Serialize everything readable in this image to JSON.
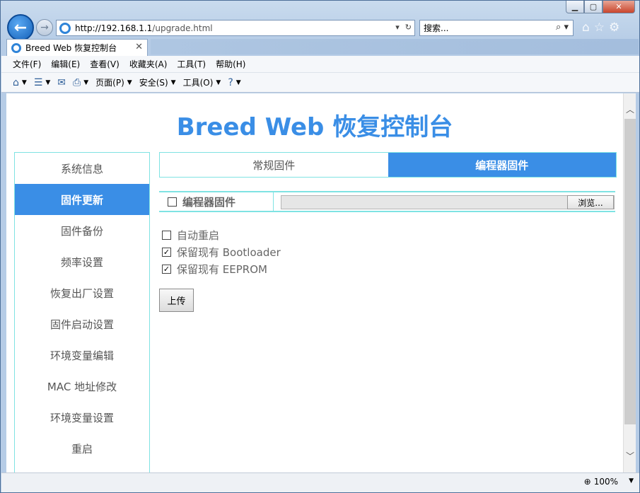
{
  "browser": {
    "url_host": "http://192.168.1.1",
    "url_path": "/upgrade.html",
    "search_placeholder": "搜索...",
    "tab_title": "Breed Web 恢复控制台",
    "menu": [
      "文件(F)",
      "编辑(E)",
      "查看(V)",
      "收藏夹(A)",
      "工具(T)",
      "帮助(H)"
    ],
    "commands": {
      "page": "页面(P)",
      "safety": "安全(S)",
      "tools": "工具(O)"
    },
    "zoom": "100%"
  },
  "page": {
    "title": "Breed Web 恢复控制台",
    "sidebar": [
      {
        "label": "系统信息",
        "active": false
      },
      {
        "label": "固件更新",
        "active": true
      },
      {
        "label": "固件备份",
        "active": false
      },
      {
        "label": "频率设置",
        "active": false
      },
      {
        "label": "恢复出厂设置",
        "active": false
      },
      {
        "label": "固件启动设置",
        "active": false
      },
      {
        "label": "环境变量编辑",
        "active": false
      },
      {
        "label": "MAC 地址修改",
        "active": false
      },
      {
        "label": "环境变量设置",
        "active": false
      },
      {
        "label": "重启",
        "active": false
      }
    ],
    "tabs": [
      {
        "label": "常规固件",
        "active": false
      },
      {
        "label": "编程器固件",
        "active": true
      }
    ],
    "file_row": {
      "label": "编程器固件",
      "checked": false,
      "browse_label": "浏览..."
    },
    "options": [
      {
        "label": "自动重启",
        "checked": false
      },
      {
        "label": "保留现有 Bootloader",
        "checked": true
      },
      {
        "label": "保留现有 EEPROM",
        "checked": true
      }
    ],
    "upload_label": "上传"
  },
  "colors": {
    "accent": "#3a8ee6",
    "border": "#7fe3e3"
  }
}
